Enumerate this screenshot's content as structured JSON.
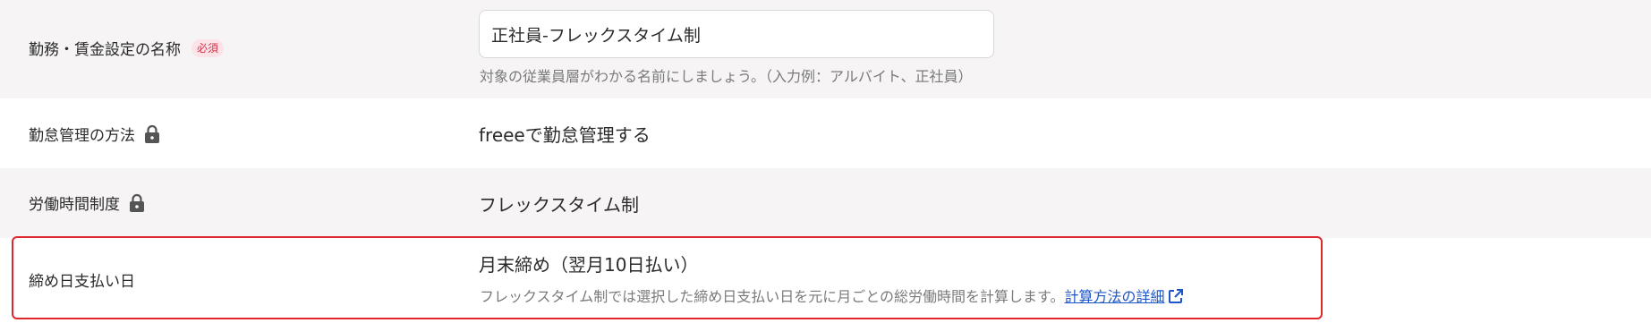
{
  "fields": {
    "name": {
      "label": "勤務・賃金設定の名称",
      "required_badge": "必須",
      "value": "正社員-フレックスタイム制",
      "help": "対象の従業員層がわかる名前にしましょう。（入力例：アルバイト、正社員）"
    },
    "attendance": {
      "label": "勤怠管理の方法",
      "lock_icon": "lock-icon",
      "value": "freeeで勤怠管理する"
    },
    "labor_system": {
      "label": "労働時間制度",
      "lock_icon": "lock-icon",
      "value": "フレックスタイム制"
    },
    "closing": {
      "label": "締め日支払い日",
      "value": "月末締め（翌月10日払い）",
      "help": "フレックスタイム制では選択した締め日支払い日を元に月ごとの総労働時間を計算します。",
      "link": "計算方法の詳細",
      "link_icon": "external-link-icon"
    }
  },
  "colors": {
    "required_bg": "#fbe3e7",
    "required_text": "#d7334a",
    "link": "#1d56c9",
    "highlight": "#e0262b",
    "row_gray": "#f6f4f4"
  }
}
